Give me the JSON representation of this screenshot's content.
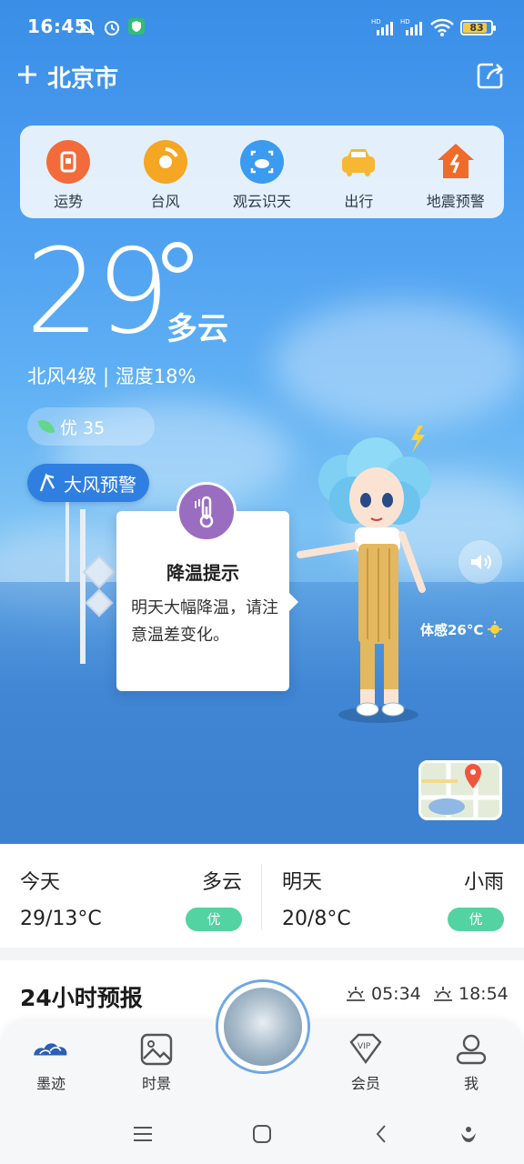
{
  "status_bar": {
    "time": "16:45",
    "battery": "83",
    "icons": [
      "mute-icon",
      "alarm-icon",
      "shield-app-icon",
      "hd-signal-icon",
      "hd-signal-icon",
      "wifi-icon",
      "battery-icon"
    ]
  },
  "header": {
    "city": "北京市",
    "add_icon": "plus-icon",
    "share_icon": "share-icon"
  },
  "tools": [
    {
      "label": "运势",
      "icon": "fortune-icon",
      "color": "#f26b3a"
    },
    {
      "label": "台风",
      "icon": "typhoon-icon",
      "color": "#f5a623"
    },
    {
      "label": "观云识天",
      "icon": "cloud-scan-icon",
      "color": "#3a9bf0"
    },
    {
      "label": "出行",
      "icon": "taxi-icon",
      "color": "#f7b733"
    },
    {
      "label": "地震预警",
      "icon": "earthquake-icon",
      "color": "#f06a2a"
    }
  ],
  "current": {
    "temperature": "29",
    "condition": "多云",
    "wind_humidity": "北风4级 | 湿度18%",
    "aqi": "优 35",
    "alert": "大风预警",
    "feels_like": "体感26°C"
  },
  "tip": {
    "title": "降温提示",
    "body": "明天大幅降温，请注意温差变化。"
  },
  "daily": [
    {
      "name": "今天",
      "condition": "多云",
      "temp": "29/13°C",
      "aqi": "优"
    },
    {
      "name": "明天",
      "condition": "小雨",
      "temp": "20/8°C",
      "aqi": "优"
    }
  ],
  "hourly": {
    "title": "24小时预报",
    "sunrise": "05:34",
    "sunset": "18:54"
  },
  "bottom_nav": [
    {
      "label": "墨迹",
      "icon": "moji-cloud-icon"
    },
    {
      "label": "时景",
      "icon": "photo-icon"
    },
    {
      "label": "会员",
      "icon": "vip-icon"
    },
    {
      "label": "我",
      "icon": "profile-icon"
    }
  ],
  "colors": {
    "accent": "#2f7fe0",
    "aqi_good": "#52d3a1",
    "tip_badge": "#9a6dc1"
  }
}
